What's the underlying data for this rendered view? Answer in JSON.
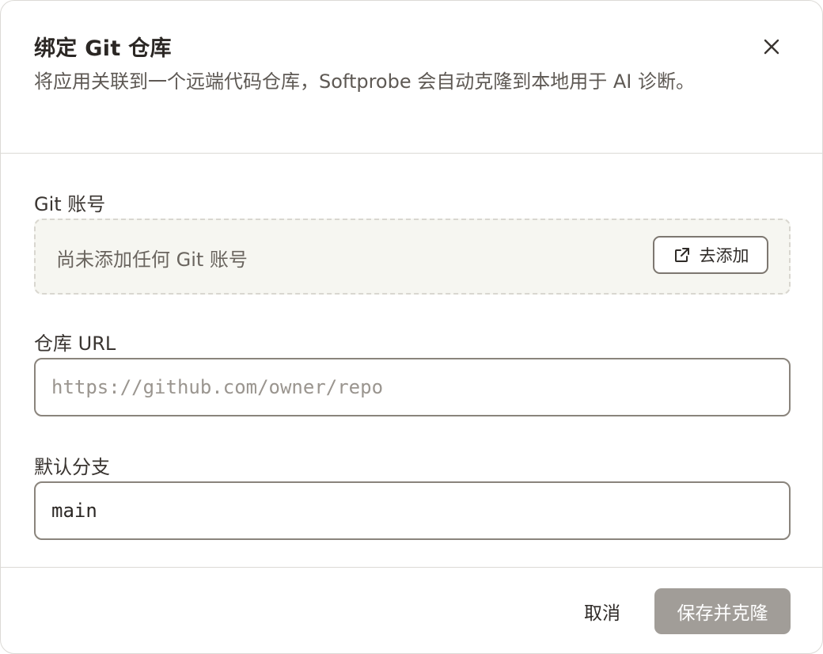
{
  "dialog": {
    "title": "绑定 Git 仓库",
    "subtitle": "将应用关联到一个远端代码仓库，Softprobe 会自动克隆到本地用于 AI 诊断。",
    "close_icon": "close-icon"
  },
  "git_account": {
    "label": "Git 账号",
    "empty_text": "尚未添加任何 Git 账号",
    "add_button_label": "去添加",
    "add_button_icon": "external-link-icon"
  },
  "repo_url": {
    "label": "仓库 URL",
    "value": "",
    "placeholder": "https://github.com/owner/repo"
  },
  "default_branch": {
    "label": "默认分支",
    "value": "main",
    "placeholder": ""
  },
  "footer": {
    "cancel_label": "取消",
    "save_label": "保存并克隆"
  },
  "colors": {
    "primary_disabled": "#a19d98",
    "dashed_box_bg": "#f6f6f1",
    "border": "#dcdad6"
  }
}
